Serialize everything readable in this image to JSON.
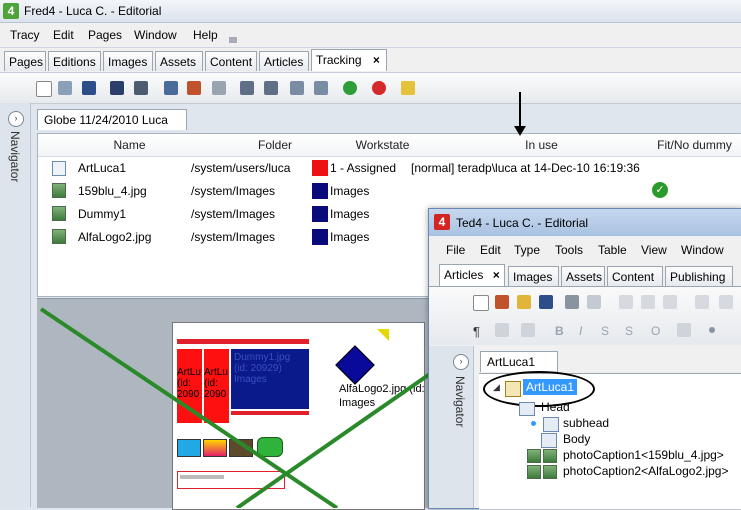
{
  "main_window": {
    "title": "Fred4 - Luca C. - Editorial",
    "menu": [
      "Tracy",
      "Edit",
      "Pages",
      "Window",
      "Help"
    ],
    "tabs": [
      "Pages",
      "Editions",
      "Images",
      "Assets",
      "Content",
      "Articles",
      "Tracking"
    ],
    "active_tab": "Tracking",
    "close_glyph": "×",
    "navigator_label": "Navigator",
    "doc_tab": "Globe 11/24/2010 Luca",
    "table": {
      "columns": [
        "Name",
        "Folder",
        "Workstate",
        "In use",
        "Fit/No dummy"
      ],
      "rows": [
        {
          "name": "ArtLuca1",
          "folder": "/system/users/luca",
          "workstate": "1 - Assigned",
          "workstate_color": "#ee1111",
          "in_use": "[normal] teradp\\luca at 14-Dec-10 16:19:36",
          "fit": "",
          "icon": "doc-icon"
        },
        {
          "name": "159blu_4.jpg",
          "folder": "/system/Images",
          "workstate": "Images",
          "workstate_color": "#0a0a7a",
          "in_use": "",
          "fit": "check",
          "icon": "image-icon"
        },
        {
          "name": "Dummy1",
          "folder": "/system/Images",
          "workstate": "Images",
          "workstate_color": "#0a0a7a",
          "in_use": "",
          "fit": "",
          "icon": "image-icon"
        },
        {
          "name": "AlfaLogo2.jpg",
          "folder": "/system/Images",
          "workstate": "Images",
          "workstate_color": "#0a0a7a",
          "in_use": "",
          "fit": "",
          "icon": "image-icon"
        }
      ]
    },
    "preview": {
      "frame_labels": [
        "ArtLu",
        "(id:",
        "2090",
        "ArtLu",
        "(id:",
        "2090"
      ],
      "image_label": "Dummy1.jpg (id: 20929) Images",
      "logo_label": "AlfaLogo2.jpg (id: 2",
      "logo_sub": "Images"
    }
  },
  "second_window": {
    "title": "Ted4 - Luca C. - Editorial",
    "menu": [
      "File",
      "Edit",
      "Type",
      "Tools",
      "Table",
      "View",
      "Window"
    ],
    "tabs": [
      "Articles",
      "Images",
      "Assets",
      "Content",
      "Publishing"
    ],
    "navigator_label": "Navigator",
    "doc_tab": "ArtLuca1",
    "tree": {
      "root": "ArtLuca1",
      "children": [
        "Head",
        "subhead",
        "Body",
        "photoCaption1<159blu_4.jpg>",
        "photoCaption2<AlfaLogo2.jpg>"
      ]
    }
  },
  "colors": {
    "accent_green": "#2a8a2a",
    "highlight_blue": "#3399ff"
  }
}
